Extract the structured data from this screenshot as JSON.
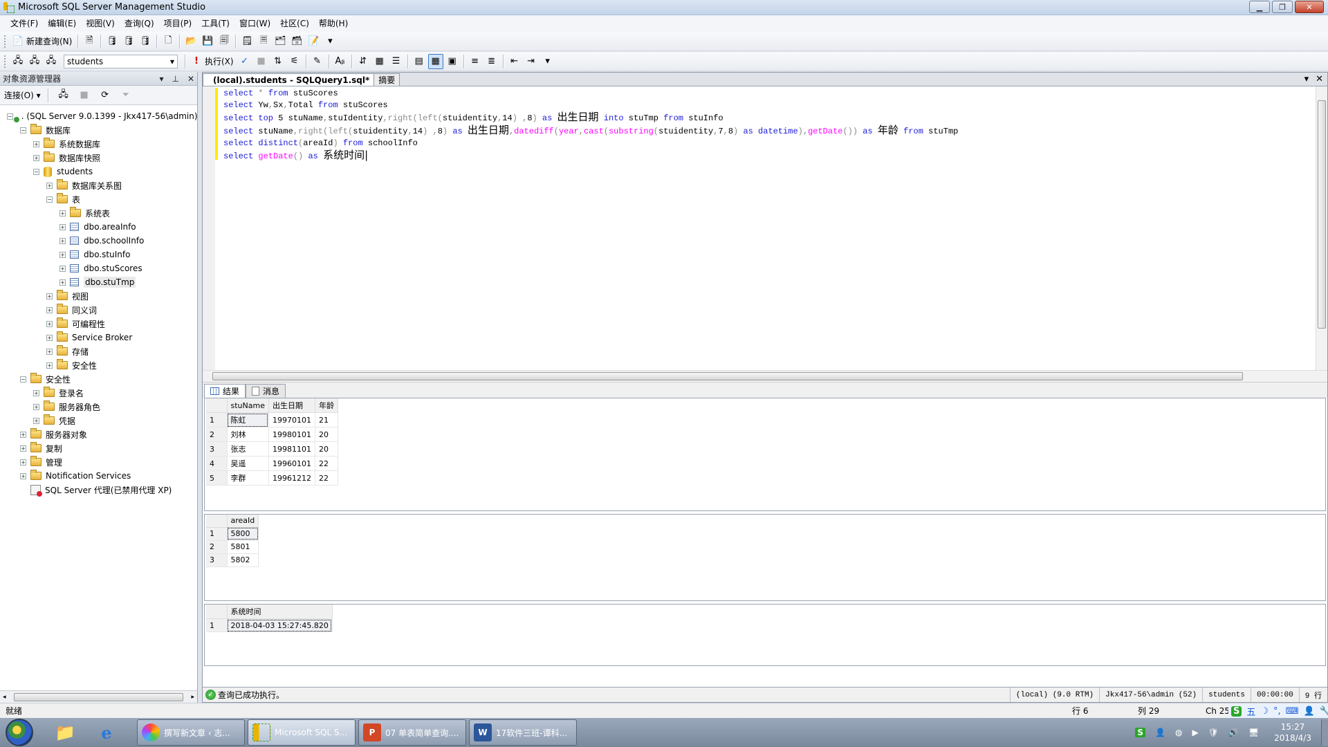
{
  "window": {
    "title": "Microsoft SQL Server Management Studio"
  },
  "menu": [
    "文件(F)",
    "编辑(E)",
    "视图(V)",
    "查询(Q)",
    "项目(P)",
    "工具(T)",
    "窗口(W)",
    "社区(C)",
    "帮助(H)"
  ],
  "toolbar": {
    "new_query": "新建查询(N)",
    "database": "students",
    "execute": "执行(X)"
  },
  "object_explorer": {
    "title": "对象资源管理器",
    "connect": "连接(O)",
    "nodes": [
      {
        "label": ". (SQL Server 9.0.1399 - Jkx417-56\\admin)",
        "level": 0,
        "exp": "-",
        "icon": "server"
      },
      {
        "label": "数据库",
        "level": 1,
        "exp": "-",
        "icon": "folder"
      },
      {
        "label": "系统数据库",
        "level": 2,
        "exp": "+",
        "icon": "folder"
      },
      {
        "label": "数据库快照",
        "level": 2,
        "exp": "+",
        "icon": "folder"
      },
      {
        "label": "students",
        "level": 2,
        "exp": "-",
        "icon": "db"
      },
      {
        "label": "数据库关系图",
        "level": 3,
        "exp": "+",
        "icon": "folder"
      },
      {
        "label": "表",
        "level": 3,
        "exp": "-",
        "icon": "folder"
      },
      {
        "label": "系统表",
        "level": 4,
        "exp": "+",
        "icon": "folder"
      },
      {
        "label": "dbo.areaInfo",
        "level": 4,
        "exp": "+",
        "icon": "table"
      },
      {
        "label": "dbo.schoolInfo",
        "level": 4,
        "exp": "+",
        "icon": "table"
      },
      {
        "label": "dbo.stuInfo",
        "level": 4,
        "exp": "+",
        "icon": "table"
      },
      {
        "label": "dbo.stuScores",
        "level": 4,
        "exp": "+",
        "icon": "table"
      },
      {
        "label": "dbo.stuTmp",
        "level": 4,
        "exp": "+",
        "icon": "table",
        "selected": true
      },
      {
        "label": "视图",
        "level": 3,
        "exp": "+",
        "icon": "folder"
      },
      {
        "label": "同义词",
        "level": 3,
        "exp": "+",
        "icon": "folder"
      },
      {
        "label": "可编程性",
        "level": 3,
        "exp": "+",
        "icon": "folder"
      },
      {
        "label": "Service Broker",
        "level": 3,
        "exp": "+",
        "icon": "folder"
      },
      {
        "label": "存储",
        "level": 3,
        "exp": "+",
        "icon": "folder"
      },
      {
        "label": "安全性",
        "level": 3,
        "exp": "+",
        "icon": "folder"
      },
      {
        "label": "安全性",
        "level": 1,
        "exp": "-",
        "icon": "folder"
      },
      {
        "label": "登录名",
        "level": 2,
        "exp": "+",
        "icon": "folder"
      },
      {
        "label": "服务器角色",
        "level": 2,
        "exp": "+",
        "icon": "folder"
      },
      {
        "label": "凭据",
        "level": 2,
        "exp": "+",
        "icon": "folder"
      },
      {
        "label": "服务器对象",
        "level": 1,
        "exp": "+",
        "icon": "folder"
      },
      {
        "label": "复制",
        "level": 1,
        "exp": "+",
        "icon": "folder"
      },
      {
        "label": "管理",
        "level": 1,
        "exp": "+",
        "icon": "folder"
      },
      {
        "label": "Notification Services",
        "level": 1,
        "exp": "+",
        "icon": "folder"
      },
      {
        "label": "SQL Server 代理(已禁用代理 XP)",
        "level": 1,
        "exp": "",
        "icon": "agent"
      }
    ]
  },
  "document": {
    "tabs": [
      {
        "label": "(local).students - SQLQuery1.sql*",
        "active": true
      },
      {
        "label": "摘要",
        "active": false
      }
    ],
    "code_lines": [
      [
        [
          "kw",
          "select "
        ],
        [
          "gr",
          "* "
        ],
        [
          "kw",
          "from "
        ],
        [
          "id",
          "stuScores"
        ]
      ],
      [
        [
          "kw",
          "select "
        ],
        [
          "id",
          "Yw"
        ],
        [
          "gr",
          ","
        ],
        [
          "id",
          "Sx"
        ],
        [
          "gr",
          ","
        ],
        [
          "id",
          "Total "
        ],
        [
          "kw",
          "from "
        ],
        [
          "id",
          "stuScores"
        ]
      ],
      [
        [
          "kw",
          "select top "
        ],
        [
          "id",
          "5 stuName"
        ],
        [
          "gr",
          ","
        ],
        [
          "id",
          "stuIdentity"
        ],
        [
          "gr",
          ",right(left("
        ],
        [
          "id",
          "stuidentity"
        ],
        [
          "gr",
          ","
        ],
        [
          "id",
          "14"
        ],
        [
          "gr",
          ") ,"
        ],
        [
          "id",
          "8"
        ],
        [
          "gr",
          ") "
        ],
        [
          "kw",
          "as "
        ],
        [
          "cn",
          "出生日期"
        ],
        [
          "kw",
          " into "
        ],
        [
          "id",
          "stuTmp "
        ],
        [
          "kw",
          "from "
        ],
        [
          "id",
          "stuInfo"
        ]
      ],
      [
        [
          "kw",
          "select "
        ],
        [
          "id",
          "stuName"
        ],
        [
          "gr",
          ",right(left("
        ],
        [
          "id",
          "stuidentity"
        ],
        [
          "gr",
          ","
        ],
        [
          "id",
          "14"
        ],
        [
          "gr",
          ") ,"
        ],
        [
          "id",
          "8"
        ],
        [
          "gr",
          ") "
        ],
        [
          "kw",
          "as "
        ],
        [
          "cn",
          "出生日期"
        ],
        [
          "gr",
          ","
        ],
        [
          "fn",
          "datediff"
        ],
        [
          "gr",
          "("
        ],
        [
          "fn",
          "year"
        ],
        [
          "gr",
          ","
        ],
        [
          "fn",
          "cast"
        ],
        [
          "gr",
          "("
        ],
        [
          "fn",
          "substring"
        ],
        [
          "gr",
          "("
        ],
        [
          "id",
          "stuidentity"
        ],
        [
          "gr",
          ","
        ],
        [
          "id",
          "7"
        ],
        [
          "gr",
          ","
        ],
        [
          "id",
          "8"
        ],
        [
          "gr",
          ") "
        ],
        [
          "kw",
          "as datetime"
        ],
        [
          "gr",
          "),"
        ],
        [
          "fn",
          "getDate"
        ],
        [
          "gr",
          "()) "
        ],
        [
          "kw",
          "as "
        ],
        [
          "cn",
          "年龄"
        ],
        [
          "kw",
          " from "
        ],
        [
          "id",
          "stuTmp"
        ]
      ],
      [
        [
          "kw",
          "select distinct"
        ],
        [
          "gr",
          "("
        ],
        [
          "id",
          "areaId"
        ],
        [
          "gr",
          ") "
        ],
        [
          "kw",
          "from "
        ],
        [
          "id",
          "schoolInfo"
        ]
      ],
      [
        [
          "kw",
          "select "
        ],
        [
          "fn",
          "getDate"
        ],
        [
          "gr",
          "() "
        ],
        [
          "kw",
          "as "
        ],
        [
          "cn",
          "系统时间|"
        ]
      ]
    ]
  },
  "results": {
    "tabs": [
      "结果",
      "消息"
    ],
    "grid1": {
      "columns": [
        "stuName",
        "出生日期",
        "年龄"
      ],
      "rows": [
        [
          "1",
          "陈虹",
          "19970101",
          "21"
        ],
        [
          "2",
          "刘林",
          "19980101",
          "20"
        ],
        [
          "3",
          "张志",
          "19981101",
          "20"
        ],
        [
          "4",
          "吴遥",
          "19960101",
          "22"
        ],
        [
          "5",
          "李群",
          "19961212",
          "22"
        ]
      ]
    },
    "grid2": {
      "columns": [
        "areaId"
      ],
      "rows": [
        [
          "1",
          "5800"
        ],
        [
          "2",
          "5801"
        ],
        [
          "3",
          "5802"
        ]
      ]
    },
    "grid3": {
      "columns": [
        "系统时间"
      ],
      "rows": [
        [
          "1",
          "2018-04-03 15:27:45.820"
        ]
      ]
    }
  },
  "exec_status": {
    "message": "查询已成功执行。",
    "server": "(local) (9.0 RTM)",
    "user": "Jkx417-56\\admin (52)",
    "database": "students",
    "elapsed": "00:00:00",
    "rows": "9 行"
  },
  "statusbar": {
    "ready": "就绪",
    "line": "行 6",
    "col": "列 29",
    "ch": "Ch 25"
  },
  "ime": [
    "S",
    "五",
    "☽",
    "°,",
    "⌨",
    "👤",
    "🔧"
  ],
  "taskbar": {
    "tasks": [
      {
        "label": "撰写新文章 ‹ 志...",
        "color": "#f0a030"
      },
      {
        "label": "Microsoft SQL S...",
        "color": "#e8b400",
        "active": true
      },
      {
        "label": "07 单表简单查询....",
        "color": "#d24726"
      },
      {
        "label": "17软件三班-谭科...",
        "color": "#2b579a"
      }
    ],
    "time": "15:27",
    "date": "2018/4/3"
  }
}
